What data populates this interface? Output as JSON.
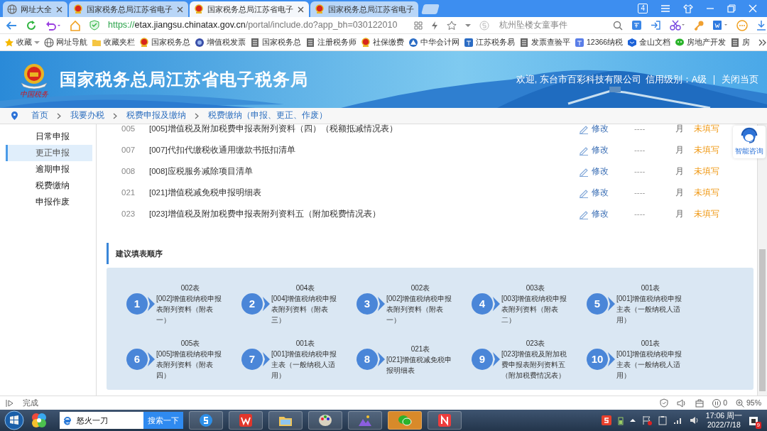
{
  "browser": {
    "tabs": [
      {
        "title": "网址大全",
        "selected": false
      },
      {
        "title": "国家税务总局江苏省电子",
        "selected": false
      },
      {
        "title": "国家税务总局江苏省电子",
        "selected": true
      },
      {
        "title": "国家税务总局江苏省电子",
        "selected": false
      }
    ],
    "tab_count": "4",
    "url": {
      "scheme": "https://",
      "host": "etax.jiangsu.chinatax.gov.cn",
      "path": "/portal/include.do?app_bh=030122010"
    },
    "search": {
      "placeholder": "杭州坠楼女童事件"
    },
    "bookmarks": [
      {
        "label": "收藏"
      },
      {
        "label": "网址导航"
      },
      {
        "label": "收藏夹栏"
      },
      {
        "label": "国家税务总"
      },
      {
        "label": "增值税发票"
      },
      {
        "label": "国家税务总"
      },
      {
        "label": "注册税务师"
      },
      {
        "label": "社保缴费"
      },
      {
        "label": "中华会计网"
      },
      {
        "label": "江苏税务易"
      },
      {
        "label": "发票查验平"
      },
      {
        "label": "12366纳税"
      },
      {
        "label": "金山文档"
      },
      {
        "label": "房地产开发"
      },
      {
        "label": "房"
      }
    ]
  },
  "header": {
    "logo_caption": "中国税务",
    "title": "国家税务总局江苏省电子税务局",
    "welcome": "欢迎, 东台市百彩科技有限公司",
    "credit": "信用级别：A级",
    "close_link": "关闭当页"
  },
  "breadcrumb": [
    "首页",
    "我要办税",
    "税费申报及缴纳",
    "税费缴纳（申报、更正、作废）"
  ],
  "sidebar": {
    "items": [
      {
        "label": "日常申报",
        "selected": false
      },
      {
        "label": "更正申报",
        "selected": true
      },
      {
        "label": "逾期申报",
        "selected": false
      },
      {
        "label": "税费缴纳",
        "selected": false
      },
      {
        "label": "申报作废",
        "selected": false
      }
    ]
  },
  "table": {
    "rows": [
      {
        "code": "005",
        "name": "[005]增值税及附加税费申报表附列资料（四）（税额抵减情况表）",
        "action": "修改",
        "column_4": "----",
        "column_5": "月",
        "status": "未填写"
      },
      {
        "code": "007",
        "name": "[007]代扣代缴税收通用缴款书抵扣清单",
        "action": "修改",
        "column_4": "----",
        "column_5": "月",
        "status": "未填写"
      },
      {
        "code": "008",
        "name": "[008]应税服务减除项目清单",
        "action": "修改",
        "column_4": "----",
        "column_5": "月",
        "status": "未填写"
      },
      {
        "code": "021",
        "name": "[021]增值税减免税申报明细表",
        "action": "修改",
        "column_4": "----",
        "column_5": "月",
        "status": "未填写"
      },
      {
        "code": "023",
        "name": "[023]增值税及附加税费申报表附列资料五（附加税费情况表）",
        "action": "修改",
        "column_4": "----",
        "column_5": "月",
        "status": "未填写"
      }
    ]
  },
  "fill_order": {
    "title": "建议填表顺序",
    "steps": [
      {
        "number": "1",
        "table": "002表",
        "description": "[002]增值税纳税申报表附列资料（附表一）"
      },
      {
        "number": "2",
        "table": "004表",
        "description": "[004]增值税纳税申报表附列资料（附表三）"
      },
      {
        "number": "3",
        "table": "002表",
        "description": "[002]增值税纳税申报表附列资料（附表一）"
      },
      {
        "number": "4",
        "table": "003表",
        "description": "[003]增值税纳税申报表附列资料（附表二）"
      },
      {
        "number": "5",
        "table": "001表",
        "description": "[001]增值税纳税申报主表（一般纳税人适用）"
      },
      {
        "number": "6",
        "table": "005表",
        "description": "[005]增值税纳税申报表附列资料（附表四）"
      },
      {
        "number": "7",
        "table": "001表",
        "description": "[001]增值税纳税申报主表（一般纳税人适用）"
      },
      {
        "number": "8",
        "table": "021表",
        "description": "[021]增值税减免税申报明细表"
      },
      {
        "number": "9",
        "table": "023表",
        "description": "[023]增值税及附加税费申报表附列资料五（附加税费情况表）"
      },
      {
        "number": "10",
        "table": "001表",
        "description": "[001]增值税纳税申报主表（一般纳税人适用）"
      }
    ]
  },
  "assistant": {
    "label": "智能咨询"
  },
  "status_bar": {
    "text": "完成",
    "count": "0",
    "zoom": "95%"
  },
  "taskbar": {
    "search_value": "怒火一刀",
    "search_button": "搜索一下",
    "time": "17:06 周一",
    "date": "2022/7/18",
    "badge": "9"
  }
}
